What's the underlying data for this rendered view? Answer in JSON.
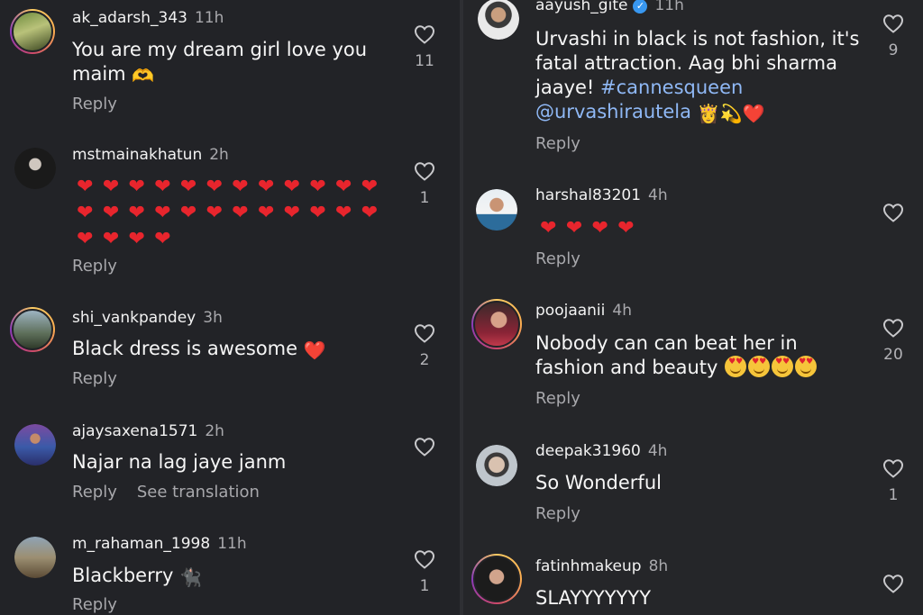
{
  "left": [
    {
      "username": "ak_adarsh_343",
      "time": "11h",
      "text": "You are my dream girl love you maim",
      "emoji": "🫶",
      "reply": "Reply",
      "likes": "11"
    },
    {
      "username": "mstmainakhatun",
      "time": "2h",
      "hearts_count": 28,
      "reply": "Reply",
      "likes": "1"
    },
    {
      "username": "shi_vankpandey",
      "time": "3h",
      "text": "Black dress is awesome",
      "emoji": "❤️",
      "reply": "Reply",
      "likes": "2"
    },
    {
      "username": "ajaysaxena1571",
      "time": "2h",
      "text": "Najar na lag jaye janm",
      "reply": "Reply",
      "translate": "See translation",
      "likes": ""
    },
    {
      "username": "m_rahaman_1998",
      "time": "11h",
      "text": "Blackberry",
      "emoji": "🐈‍⬛",
      "reply": "Reply",
      "likes": "1"
    }
  ],
  "right": [
    {
      "username": "aayush_gite",
      "time": "11h",
      "text_line1": "Urvashi in black is not fashion, it's",
      "text_line2": "fatal attraction. Aag bhi sharma",
      "text_line3": "jaaye!",
      "hashtag": "#cannesqueen",
      "mention": "@urvashirautela",
      "emoji": "👸💫❤️",
      "reply": "Reply",
      "likes": "9"
    },
    {
      "username": "harshal83201",
      "time": "4h",
      "hearts_count": 4,
      "reply": "Reply",
      "likes": ""
    },
    {
      "username": "poojaanii",
      "time": "4h",
      "text_line1": "Nobody can can beat her in",
      "text_line2": "fashion and beauty",
      "emoji": "😍😍😍😍",
      "reply": "Reply",
      "likes": "20"
    },
    {
      "username": "deepak31960",
      "time": "4h",
      "text": "So Wonderful",
      "reply": "Reply",
      "likes": "1"
    },
    {
      "username": "fatinhmakeup",
      "time": "8h",
      "text": "SLAYYYYYYY",
      "likes": ""
    }
  ]
}
